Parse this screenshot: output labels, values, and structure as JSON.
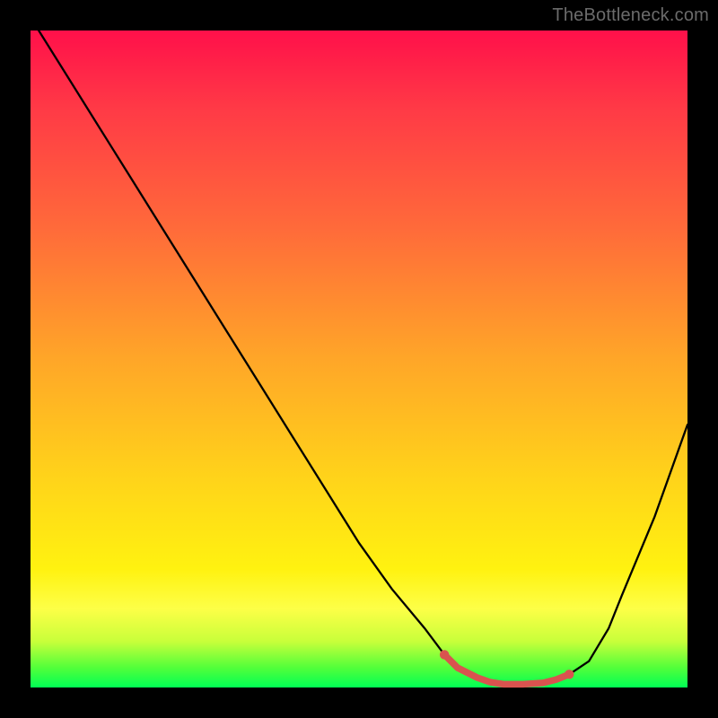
{
  "attribution": "TheBottleneck.com",
  "colors": {
    "background": "#000000",
    "gradient_top": "#ff104a",
    "gradient_bottom": "#00ff55",
    "curve_stroke": "#000000",
    "marker_stroke": "#d9534f",
    "marker_fill": "#d9534f"
  },
  "chart_data": {
    "type": "line",
    "title": "",
    "xlabel": "",
    "ylabel": "",
    "xlim": [
      0,
      100
    ],
    "ylim": [
      0,
      100
    ],
    "x": [
      0,
      5,
      10,
      15,
      20,
      25,
      30,
      35,
      40,
      45,
      50,
      55,
      60,
      63,
      65,
      68,
      70,
      72,
      75,
      78,
      80,
      82,
      85,
      88,
      90,
      95,
      100
    ],
    "values": [
      102,
      94,
      86,
      78,
      70,
      62,
      54,
      46,
      38,
      30,
      22,
      15,
      9,
      5,
      3,
      1.5,
      0.8,
      0.5,
      0.5,
      0.7,
      1.2,
      2,
      4,
      9,
      14,
      26,
      40
    ],
    "optimal_region": {
      "x": [
        63,
        65,
        68,
        70,
        72,
        75,
        78,
        80,
        82
      ],
      "values": [
        5,
        3,
        1.5,
        0.8,
        0.5,
        0.5,
        0.7,
        1.2,
        2
      ]
    }
  }
}
